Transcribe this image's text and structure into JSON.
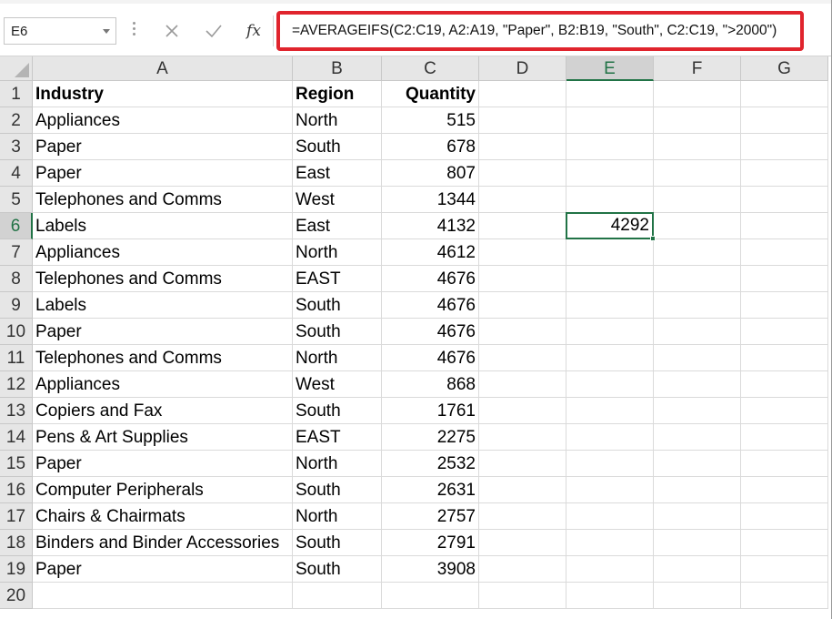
{
  "formula_bar": {
    "name_box": "E6",
    "cancel_icon": "close-icon",
    "enter_icon": "check-icon",
    "fx_label": "fx",
    "formula": "=AVERAGEIFS(C2:C19, A2:A19, \"Paper\", B2:B19, \"South\", C2:C19, \">2000\")",
    "highlight_color": "#e0242d"
  },
  "columns": [
    "A",
    "B",
    "C",
    "D",
    "E",
    "F",
    "G"
  ],
  "rows": [
    "1",
    "2",
    "3",
    "4",
    "5",
    "6",
    "7",
    "8",
    "9",
    "10",
    "11",
    "12",
    "13",
    "14",
    "15",
    "16",
    "17",
    "18",
    "19",
    "20"
  ],
  "selected": {
    "column": "E",
    "row": "6",
    "accent": "#217346"
  },
  "headers": {
    "industry": "Industry",
    "region": "Region",
    "quantity": "Quantity"
  },
  "data": [
    {
      "industry": "Appliances",
      "region": "North",
      "quantity": "515"
    },
    {
      "industry": "Paper",
      "region": "South",
      "quantity": "678"
    },
    {
      "industry": "Paper",
      "region": "East",
      "quantity": "807"
    },
    {
      "industry": "Telephones and Comms",
      "region": "West",
      "quantity": "1344"
    },
    {
      "industry": "Labels",
      "region": "East",
      "quantity": "4132"
    },
    {
      "industry": "Appliances",
      "region": "North",
      "quantity": "4612"
    },
    {
      "industry": "Telephones and Comms",
      "region": "EAST",
      "quantity": "4676"
    },
    {
      "industry": "Labels",
      "region": "South",
      "quantity": "4676"
    },
    {
      "industry": "Paper",
      "region": "South",
      "quantity": "4676"
    },
    {
      "industry": "Telephones and Comms",
      "region": "North",
      "quantity": "4676"
    },
    {
      "industry": "Appliances",
      "region": "West",
      "quantity": "868"
    },
    {
      "industry": "Copiers and Fax",
      "region": "South",
      "quantity": "1761"
    },
    {
      "industry": "Pens & Art Supplies",
      "region": "EAST",
      "quantity": "2275"
    },
    {
      "industry": "Paper",
      "region": "North",
      "quantity": "2532"
    },
    {
      "industry": "Computer Peripherals",
      "region": "South",
      "quantity": "2631"
    },
    {
      "industry": "Chairs & Chairmats",
      "region": "North",
      "quantity": "2757"
    },
    {
      "industry": "Binders and Binder Accessories",
      "region": "South",
      "quantity": "2791"
    },
    {
      "industry": "Paper",
      "region": "South",
      "quantity": "3908"
    }
  ],
  "result_cell": {
    "ref": "E6",
    "value": "4292"
  }
}
